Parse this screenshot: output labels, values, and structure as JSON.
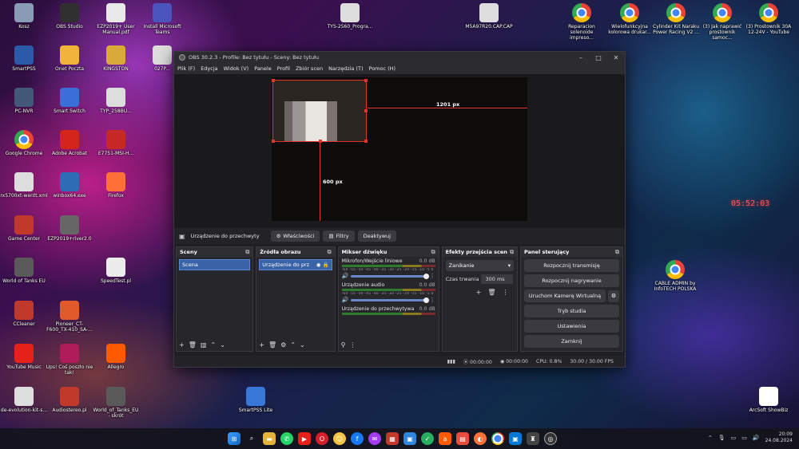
{
  "desktop": {
    "col1": [
      {
        "label": "Kosz",
        "icon": "recycle-bin-icon"
      },
      {
        "label": "SmartPSS",
        "icon": "smartpss-icon"
      },
      {
        "label": "PC-NVR",
        "icon": "pc-nvr-icon"
      },
      {
        "label": "Google Chrome",
        "icon": "chrome-icon"
      },
      {
        "label": "rx5700xt-wentt.xml",
        "icon": "file-icon"
      },
      {
        "label": "Game Center",
        "icon": "game-center-icon"
      },
      {
        "label": "World of Tanks EU",
        "icon": "wot-icon"
      },
      {
        "label": "CCleaner",
        "icon": "ccleaner-icon"
      },
      {
        "label": "YouTube Music",
        "icon": "youtube-music-icon"
      },
      {
        "label": "de-evolution-kit-s...",
        "icon": "file-icon"
      }
    ],
    "col2": [
      {
        "label": "OBS Studio",
        "icon": "obs-icon"
      },
      {
        "label": "Onet Poczta",
        "icon": "mail-icon"
      },
      {
        "label": "Smart Switch",
        "icon": "smart-switch-icon"
      },
      {
        "label": "Adobe Acrobat",
        "icon": "acrobat-icon"
      },
      {
        "label": "winbox64.exe",
        "icon": "winbox-icon"
      },
      {
        "label": "EZP2019+river2.0",
        "icon": "ezp-icon"
      },
      {
        "label": "",
        "icon": ""
      },
      {
        "label": "Pioneer_CT-F600_TX-410_SA-...",
        "icon": "pioneer-icon"
      },
      {
        "label": "Ups! Coś poszło nie tak!",
        "icon": "error-app-icon"
      },
      {
        "label": "Audiostereo.pl",
        "icon": "audiostereo-icon"
      }
    ],
    "col3": [
      {
        "label": "EZP2019+ User Manual.pdf",
        "icon": "pdf-icon"
      },
      {
        "label": "KINGSTON",
        "icon": "folder-icon"
      },
      {
        "label": "TYP_258BU...",
        "icon": "file-icon"
      },
      {
        "label": "E7751-MSI-H...",
        "icon": "msi-icon"
      },
      {
        "label": "Firefox",
        "icon": "firefox-icon"
      },
      {
        "label": "",
        "icon": ""
      },
      {
        "label": "SpeedTest.pl",
        "icon": "speedtest-icon"
      },
      {
        "label": "",
        "icon": ""
      },
      {
        "label": "Allegro",
        "icon": "allegro-icon"
      },
      {
        "label": "World_of_Tanks_EU - skrót",
        "icon": "wot-icon"
      }
    ],
    "col4": [
      {
        "label": "Install Microsoft Teams",
        "icon": "teams-icon"
      },
      {
        "label": "027P...",
        "icon": "file-icon"
      },
      {
        "label": "",
        "icon": ""
      },
      {
        "label": "SmartPSS Lite",
        "icon": "smartpss-lite-icon"
      }
    ],
    "top_center": [
      {
        "label": "TYS-2560_Progra...",
        "icon": "file-icon"
      },
      {
        "label": "M5A97R20.CAP.CAP",
        "icon": "file-icon"
      }
    ],
    "top_right": [
      {
        "label": "Reparacion solenoide impreso...",
        "icon": "chrome-icon"
      },
      {
        "label": "Wielofunkcyjna kolorowa drukar...",
        "icon": "chrome-icon"
      },
      {
        "label": "Cylinder Kit Naraku Power Racing V2 ...",
        "icon": "chrome-icon"
      },
      {
        "label": "(3) Jak naprawić prostownik samoc...",
        "icon": "chrome-icon"
      },
      {
        "label": "(3) Prostownik 30A 12-24V - YouTube",
        "icon": "chrome-icon"
      }
    ],
    "right": [
      {
        "label": "CABLE ADMIN by InfoTECH POLSKA",
        "icon": "chrome-icon"
      },
      {
        "label": "ArcSoft ShowBiz",
        "icon": "arcsoft-icon"
      }
    ],
    "wall_clock": "05:52:03"
  },
  "obs": {
    "title": "OBS 30.2.3 - Profile: Bez tytułu - Sceny: Bez tytułu",
    "menu": [
      "Plik (F)",
      "Edycja",
      "Widok (V)",
      "Panele",
      "Profil",
      "Zbiór scen",
      "Narzędzia (T)",
      "Pomoc (H)"
    ],
    "guide_h": "1201 px",
    "guide_v": "600 px",
    "source_bar": {
      "name": "Urządzenie do przechwyty",
      "properties": "Właściwości",
      "filters": "Filtry",
      "deactivate": "Deaktywuj"
    },
    "scenes": {
      "title": "Sceny",
      "items": [
        "Scena"
      ]
    },
    "sources": {
      "title": "Źródła obrazu",
      "items": [
        "Urządzenie do prz"
      ]
    },
    "mixer": {
      "title": "Mikser dźwięku",
      "channels": [
        {
          "name": "Mikrofon/Wejście liniowe",
          "db": "0.0 dB"
        },
        {
          "name": "Urządzenie audio",
          "db": "0.0 dB"
        },
        {
          "name": "Urządzenie do przechwytywa",
          "db": "0.0 dB"
        }
      ],
      "scale": "-60 -55 -50 -45 -40 -35 -30 -25 -20 -15 -10 -5 0"
    },
    "transitions": {
      "title": "Efekty przejścia scen",
      "type": "Zanikanie",
      "duration_label": "Czas trwania",
      "duration": "300 ms"
    },
    "controls": {
      "title": "Panel sterujący",
      "start_stream": "Rozpocznij transmisję",
      "start_record": "Rozpocznij nagrywanie",
      "virtual_cam": "Uruchom Kamerę Wirtualną",
      "studio_mode": "Tryb studia",
      "settings": "Ustawienia",
      "exit": "Zamknij"
    },
    "status": {
      "rec_time": "00:00:00",
      "stream_time": "00:00:00",
      "cpu": "CPU: 0.8%",
      "fps": "30.00 / 30.00 FPS"
    }
  },
  "taskbar": {
    "time": "20:09",
    "date": "24.08.2024"
  }
}
